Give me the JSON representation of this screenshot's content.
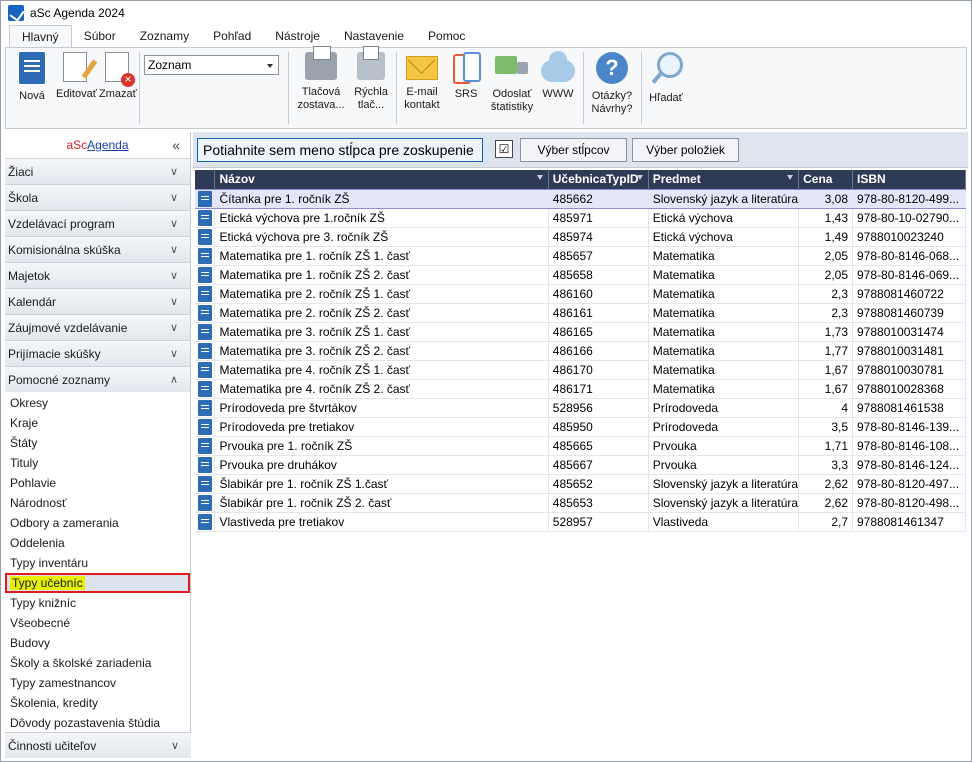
{
  "window": {
    "title": "aSc Agenda 2024"
  },
  "menu_tabs": [
    "Hlavný",
    "Súbor",
    "Zoznamy",
    "Pohľad",
    "Nástroje",
    "Nastavenie",
    "Pomoc"
  ],
  "ribbon": {
    "nova": "Nová",
    "editovat": "Editovať",
    "zmazat": "Zmazať",
    "list_combo": "Zoznam",
    "print_line1": "Tlačová",
    "print_line2": "zostava...",
    "quick_print_line1": "Rýchla",
    "quick_print_line2": "tlač...",
    "email_line1": "E-mail",
    "email_line2": "kontakt",
    "srs": "SRS",
    "send_stats_line1": "Odoslať",
    "send_stats_line2": "štatistiky",
    "www": "WWW",
    "questions_line1": "Otázky?",
    "questions_line2": "Návrhy?",
    "search": "Hľadať"
  },
  "sidebar": {
    "brand_a": "aSc",
    "brand_b": "Agenda",
    "collapse_glyph": "«",
    "groups": [
      "Žiaci",
      "Škola",
      "Vzdelávací program",
      "Komisionálna skúška",
      "Majetok",
      "Kalendár",
      "Záujmové vzdelávanie",
      "Prijímacie skúšky",
      "Pomocné zoznamy"
    ],
    "items": [
      "Okresy",
      "Kraje",
      "Štáty",
      "Tituly",
      "Pohlavie",
      "Národnosť",
      "Odbory a zamerania",
      "Oddelenia",
      "Typy inventáru",
      "Typy učebníc",
      "Typy knižníc",
      "Všeobecné",
      "Budovy",
      "Školy a školské zariadenia",
      "Typy zamestnancov",
      "Školenia, kredity",
      "Dôvody pozastavenia štúdia"
    ],
    "bottom_group": "Činnosti učiteľov"
  },
  "grid": {
    "group_hint": "Potiahnite sem meno stĺpca pre zoskupenie",
    "checkbox_glyph": "☑",
    "choose_columns": "Výber stĺpcov",
    "choose_items": "Výber položiek",
    "columns": [
      "Názov",
      "UčebnicaTypID",
      "Predmet",
      "Cena",
      "ISBN"
    ],
    "rows": [
      [
        "Čítanka pre 1. ročník ZŠ",
        "485662",
        "Slovenský jazyk a literatúra",
        "3,08",
        "978-80-8120-499..."
      ],
      [
        "Etická  výchova pre 1.ročník ZŠ",
        "485971",
        "Etická výchova",
        "1,43",
        "978-80-10-02790..."
      ],
      [
        "Etická výchova pre 3. ročník ZŠ",
        "485974",
        "Etická výchova",
        "1,49",
        "9788010023240"
      ],
      [
        "Matematika pre 1. ročník ZŠ 1. časť",
        "485657",
        "Matematika",
        "2,05",
        "978-80-8146-068..."
      ],
      [
        "Matematika pre 1. ročník ZŠ 2. časť",
        "485658",
        "Matematika",
        "2,05",
        "978-80-8146-069..."
      ],
      [
        "Matematika pre 2. ročník ZŠ 1. časť",
        "486160",
        "Matematika",
        "2,3",
        "9788081460722"
      ],
      [
        "Matematika pre 2. ročník ZŠ 2. časť",
        "486161",
        "Matematika",
        "2,3",
        "9788081460739"
      ],
      [
        "Matematika pre 3. ročník ZŠ 1. časť",
        "486165",
        "Matematika",
        "1,73",
        "9788010031474"
      ],
      [
        "Matematika pre 3. ročník ZŠ 2. časť",
        "486166",
        "Matematika",
        "1,77",
        "9788010031481"
      ],
      [
        "Matematika pre 4. ročník ZŠ 1. časť",
        "486170",
        "Matematika",
        "1,67",
        "9788010030781"
      ],
      [
        "Matematika pre 4. ročník ZŠ 2. časť",
        "486171",
        "Matematika",
        "1,67",
        "9788010028368"
      ],
      [
        "Prírodoveda pre štvrtákov",
        "528956",
        "Prírodoveda",
        "4",
        "9788081461538"
      ],
      [
        "Prírodoveda pre tretiakov",
        "485950",
        "Prírodoveda",
        "3,5",
        "978-80-8146-139..."
      ],
      [
        "Prvouka pre 1. ročník ZŠ",
        "485665",
        "Prvouka",
        "1,71",
        "978-80-8146-108..."
      ],
      [
        "Prvouka pre druhákov",
        "485667",
        "Prvouka",
        "3,3",
        "978-80-8146-124..."
      ],
      [
        "Šlabikár pre 1. ročník ZŠ 1.časť",
        "485652",
        "Slovenský jazyk a literatúra",
        "2,62",
        "978-80-8120-497..."
      ],
      [
        "Šlabikár pre 1. ročník ZŠ 2. časť",
        "485653",
        "Slovenský jazyk a literatúra",
        "2,62",
        "978-80-8120-498..."
      ],
      [
        "Vlastiveda pre tretiakov",
        "528957",
        "Vlastiveda",
        "2,7",
        "9788081461347"
      ]
    ]
  }
}
